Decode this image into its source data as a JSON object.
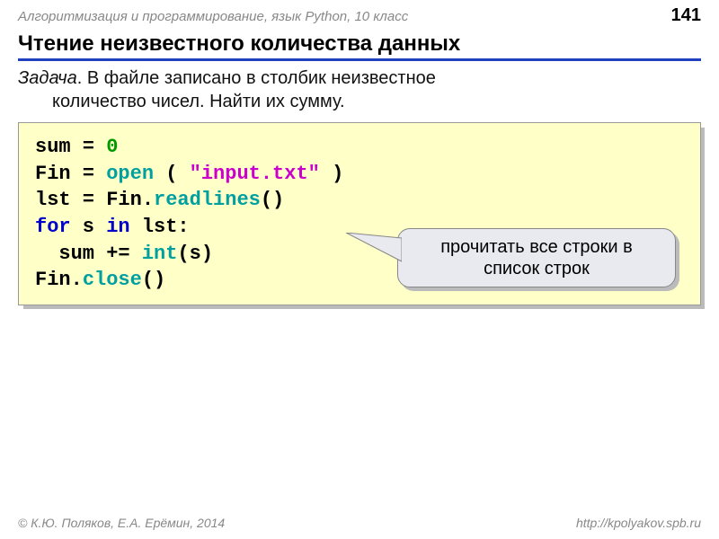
{
  "header": {
    "course": "Алгоритмизация и программирование, язык Python, 10 класс",
    "page": "141"
  },
  "title": "Чтение неизвестного количества данных",
  "task": {
    "label": "Задача",
    "text_line1": ". В файле записано в столбик неизвестное",
    "text_line2": "количество чисел. Найти их сумму."
  },
  "code": {
    "t1": "sum",
    "eq1": " = ",
    "zero": "0",
    "t2": "Fin",
    "eq2": " = ",
    "open": "open",
    "paren_sp": " ( ",
    "str": "\"input.txt\"",
    "cparen": " )",
    "t3": "lst",
    "eq3": " = ",
    "fin1": "Fin.",
    "readlines": "readlines",
    "empty_call": "()",
    "kw_for": "for",
    "sp1": " s ",
    "kw_in": "in",
    "sp2": " lst:",
    "indent": "  sum += ",
    "int": "int",
    "arg_s": "(s)",
    "fin2": "Fin.",
    "close": "close",
    "empty_call2": "()"
  },
  "callout": "прочитать все строки в список строк",
  "footer": {
    "left": "© К.Ю. Поляков, Е.А. Ерёмин, 2014",
    "right": "http://kpolyakov.spb.ru"
  }
}
